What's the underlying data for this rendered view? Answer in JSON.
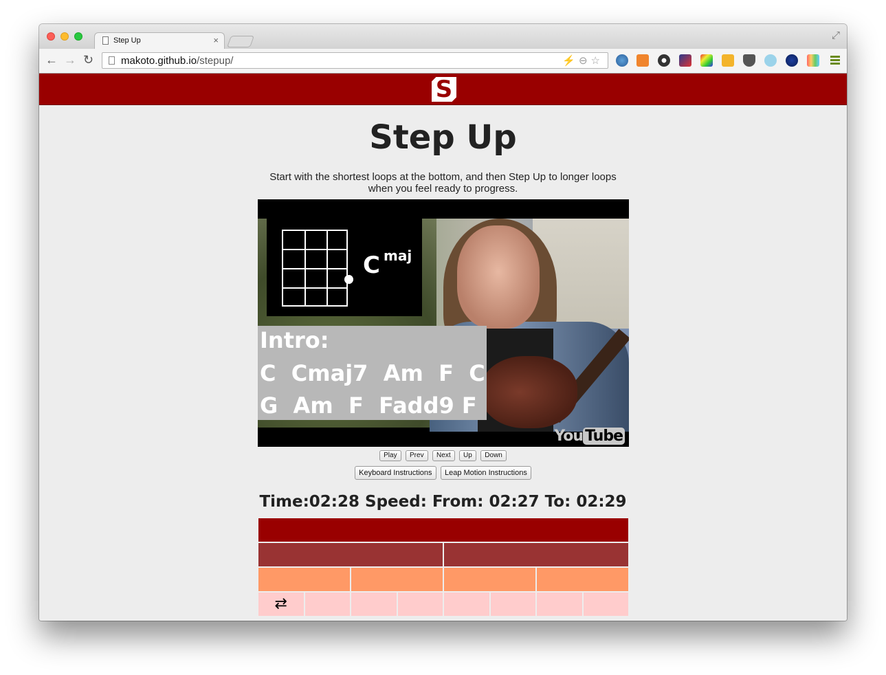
{
  "browser": {
    "tab_title": "Step Up",
    "tab_close": "×",
    "url_host": "makoto.github.io",
    "url_path": "/stepup/",
    "nav": {
      "back": "←",
      "forward": "→",
      "reload": "↻"
    },
    "omnibox_icons": "⚡⊖☆",
    "fullscreen_icon": "⤢"
  },
  "site": {
    "logo": "S",
    "title": "Step Up",
    "intro": "Start with the shortest loops at the bottom, and then Step Up to longer loops when you feel ready to progress."
  },
  "video": {
    "chord_name": "C",
    "chord_suffix": "maj",
    "lyrics": [
      "Intro:",
      "C  Cmaj7  Am  F  C",
      "G  Am  F  Fadd9 F"
    ],
    "youtube_you": "You",
    "youtube_tube": "Tube"
  },
  "controls": {
    "play": "Play",
    "prev": "Prev",
    "next": "Next",
    "up": "Up",
    "down": "Down",
    "keyboard": "Keyboard Instructions",
    "leap": "Leap Motion Instructions"
  },
  "status": {
    "time_text": "Time:02:28 Speed: From: 02:27 To: 02:29"
  },
  "loops": {
    "rows": [
      1,
      2,
      4,
      8
    ],
    "active_row": 3,
    "active_cell": 0,
    "repeat_icon": "repeat-icon",
    "colors": [
      "#990000",
      "#993333",
      "#ff9966",
      "#ffcccc"
    ]
  },
  "extension_icons": [
    "globe-icon",
    "rss-icon",
    "gear-icon",
    "image-icon",
    "palette-icon",
    "box-icon",
    "pocket-icon",
    "drop-icon",
    "ftp-icon",
    "rainbow-icon",
    "menu-icon"
  ]
}
